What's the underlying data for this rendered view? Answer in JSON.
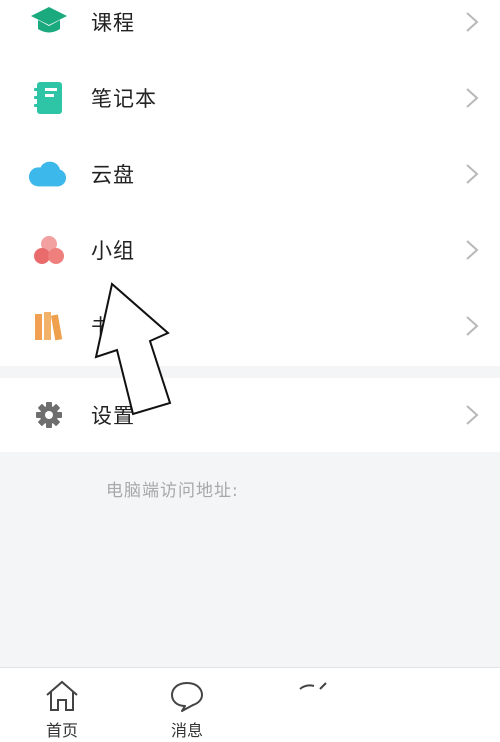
{
  "menu": {
    "items": [
      {
        "label": "课程",
        "icon": "graduation-cap-icon",
        "color": "#1aaa7d"
      },
      {
        "label": "笔记本",
        "icon": "notebook-icon",
        "color": "#2ec4a6"
      },
      {
        "label": "云盘",
        "icon": "cloud-icon",
        "color": "#3db8ea"
      },
      {
        "label": "小组",
        "icon": "group-icon",
        "color": "#ef6f6c"
      },
      {
        "label": "书架",
        "icon": "bookshelf-icon",
        "color": "#f0a050"
      },
      {
        "label": "设置",
        "icon": "gear-icon",
        "color": "#6e6e6e"
      }
    ]
  },
  "footer": {
    "pc_address_label": "电脑端访问地址:"
  },
  "tabbar": {
    "tabs": [
      {
        "label": "首页",
        "icon": "home-icon"
      },
      {
        "label": "消息",
        "icon": "chat-bubble-icon"
      },
      {
        "label": "",
        "icon": "partial-icon"
      }
    ]
  }
}
